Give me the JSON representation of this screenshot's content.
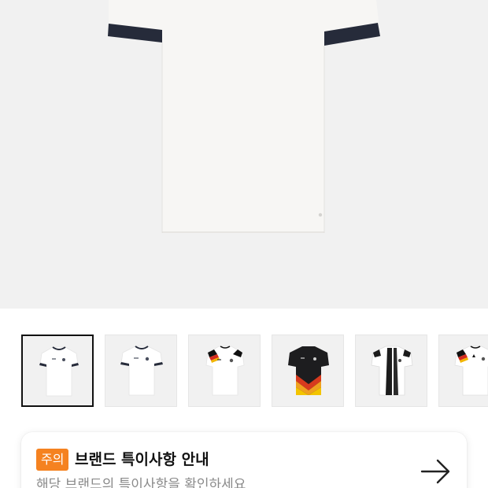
{
  "product": {
    "main_image": "white-jersey-product-photo",
    "colors": {
      "shirt": "#f7f6f4",
      "trim": "#262b3a",
      "hero_bg": "#f1f1f1"
    }
  },
  "thumbnails": [
    {
      "image": "white-jersey-navy-trim",
      "selected": true
    },
    {
      "image": "white-jersey-navy-trim-alt",
      "selected": false
    },
    {
      "image": "germany-home-jersey-tricolor-shoulders",
      "selected": false
    },
    {
      "image": "germany-away-jersey-black-flame",
      "selected": false
    },
    {
      "image": "germany-jersey-black-white-stripes",
      "selected": false
    },
    {
      "image": "germany-home-jersey-partial",
      "selected": false
    }
  ],
  "notice": {
    "badge": "주의",
    "title": "브랜드 특이사항 안내",
    "subtitle": "해당 브랜드의 특이사항을 확인하세요",
    "badge_color": "#f58220",
    "arrow_icon": "arrow-right-icon"
  }
}
